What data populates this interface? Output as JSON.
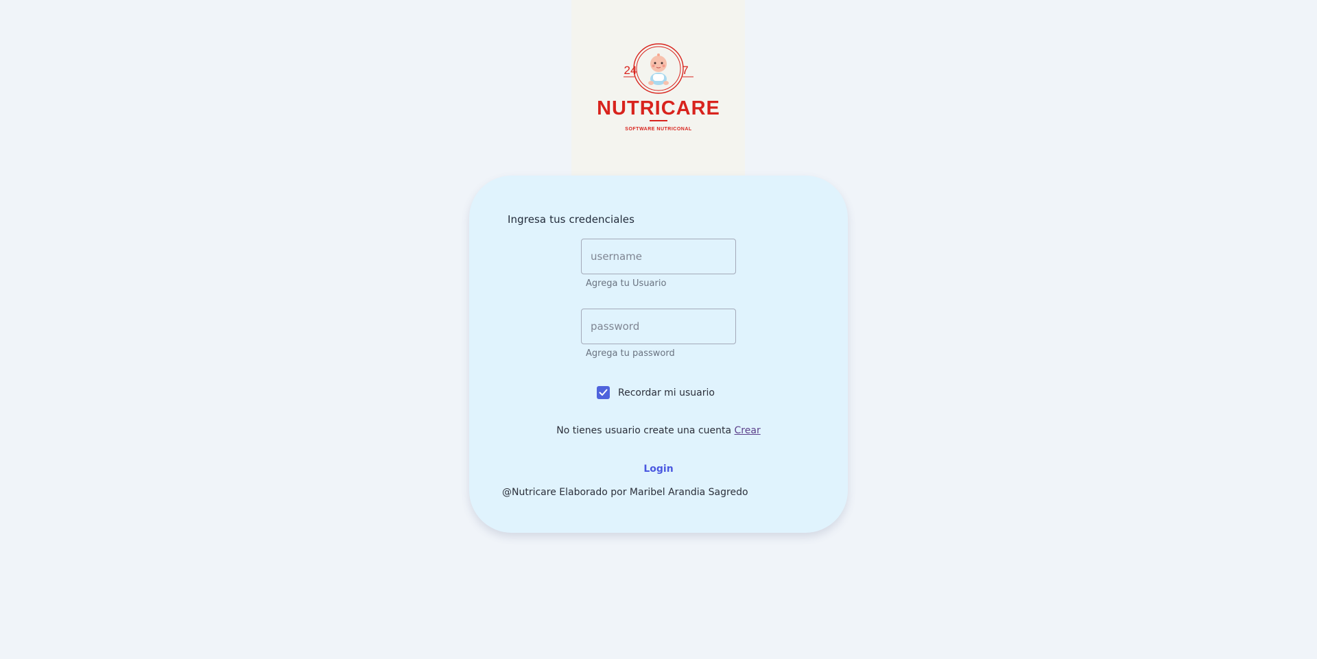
{
  "logo": {
    "left_number": "24",
    "right_number": "7",
    "brand": "NUTRICARE",
    "tagline": "SOFTWARE NUTRICONAL"
  },
  "login_form": {
    "title": "Ingresa tus credenciales",
    "username": {
      "placeholder": "username",
      "value": "",
      "helper": "Agrega tu Usuario"
    },
    "password": {
      "placeholder": "password",
      "value": "",
      "helper": "Agrega tu password"
    },
    "remember": {
      "label": "Recordar mi usuario",
      "checked": true
    },
    "signup": {
      "text": "No tienes usuario create una cuenta",
      "link_label": "Crear"
    },
    "login_label": "Login",
    "footer": "@Nutricare Elaborado por Maribel Arandia Sagredo"
  },
  "colors": {
    "background": "#f0f4f9",
    "card": "#e0f3fd",
    "brand_red": "#d8231d",
    "accent": "#4f63dc"
  },
  "icons": {
    "logo_mascot": "baby-icon",
    "checkbox": "check-icon"
  }
}
